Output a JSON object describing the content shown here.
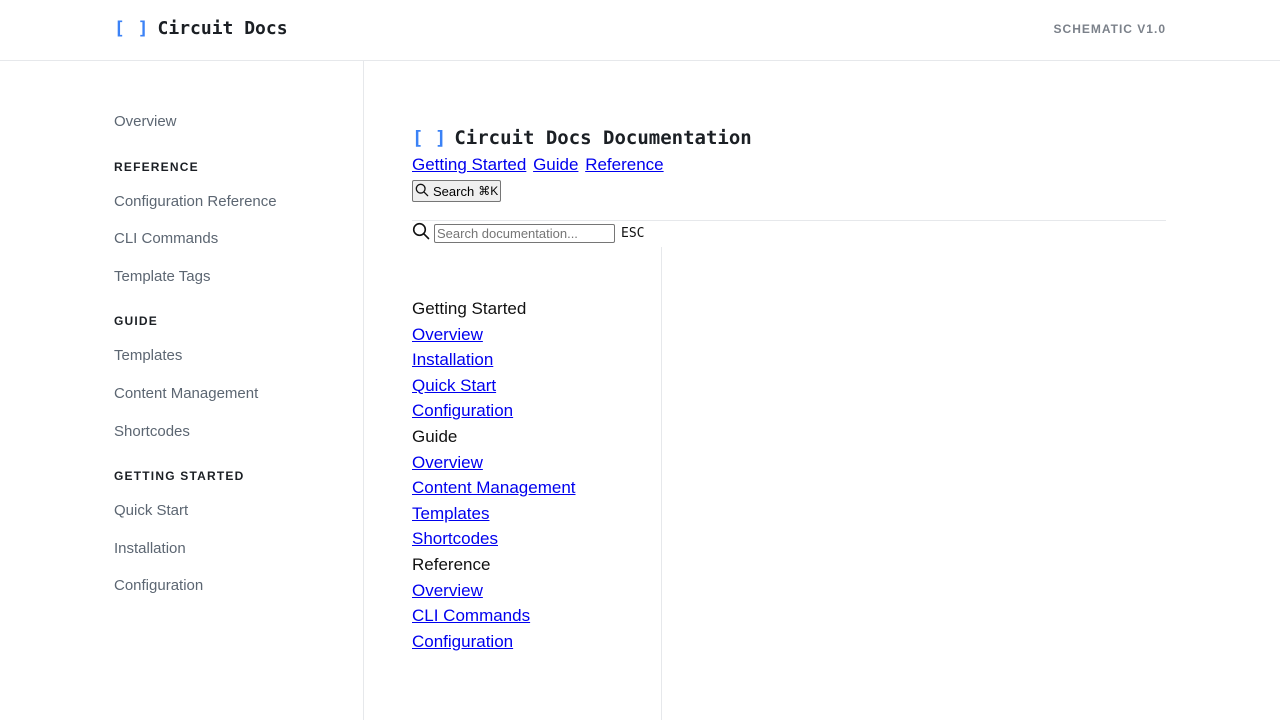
{
  "header": {
    "brand_brackets": "[ ]",
    "brand_name": "Circuit Docs",
    "version": "SCHEMATIC V1.0"
  },
  "sidebar": {
    "top_link": "Overview",
    "sections": [
      {
        "heading": "REFERENCE",
        "items": [
          "Configuration Reference",
          "CLI Commands",
          "Template Tags"
        ]
      },
      {
        "heading": "GUIDE",
        "items": [
          "Templates",
          "Content Management",
          "Shortcodes"
        ]
      },
      {
        "heading": "GETTING STARTED",
        "items": [
          "Quick Start",
          "Installation",
          "Configuration"
        ]
      }
    ]
  },
  "main": {
    "title_brackets": "[ ]",
    "title": "Circuit Docs Documentation",
    "top_links": [
      "Getting Started",
      "Guide",
      "Reference"
    ],
    "search_button": {
      "label": "Search",
      "shortcut": "⌘K",
      "icon": "search-icon"
    },
    "search_input": {
      "placeholder": "Search documentation...",
      "value": ""
    },
    "esc_label": "ESC",
    "nav_groups": [
      {
        "label": "Getting Started",
        "links": [
          "Overview",
          "Installation",
          "Quick Start",
          "Configuration"
        ]
      },
      {
        "label": "Guide",
        "links": [
          "Overview",
          "Content Management",
          "Templates",
          "Shortcodes"
        ]
      },
      {
        "label": "Reference",
        "links": [
          "Overview",
          "CLI Commands",
          "Configuration"
        ]
      }
    ]
  },
  "colors": {
    "accent": "#3b82f6",
    "link": "#0000ee",
    "muted": "#5c6672"
  }
}
